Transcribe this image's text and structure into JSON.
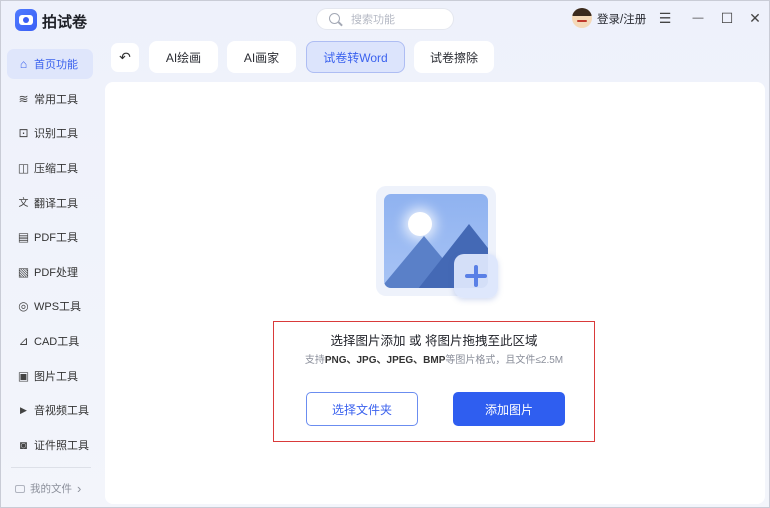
{
  "app": {
    "title": "拍试卷"
  },
  "search": {
    "placeholder": "搜索功能"
  },
  "account": {
    "login_label": "登录/注册"
  },
  "window_controls": {
    "menu": "☰",
    "minimize": "—",
    "maximize": "☐",
    "close": "✕"
  },
  "sidebar": {
    "items": [
      {
        "label": "首页功能",
        "icon": "home-icon",
        "glyph": "⌂",
        "active": true
      },
      {
        "label": "常用工具",
        "icon": "layers-icon",
        "glyph": "≋"
      },
      {
        "label": "识别工具",
        "icon": "scan-icon",
        "glyph": "⊡"
      },
      {
        "label": "压缩工具",
        "icon": "compress-icon",
        "glyph": "◫"
      },
      {
        "label": "翻译工具",
        "icon": "translate-icon",
        "glyph": "文"
      },
      {
        "label": "PDF工具",
        "icon": "pdf-icon",
        "glyph": "▤"
      },
      {
        "label": "PDF处理",
        "icon": "pdf-process-icon",
        "glyph": "▧"
      },
      {
        "label": "WPS工具",
        "icon": "wps-icon",
        "glyph": "◎"
      },
      {
        "label": "CAD工具",
        "icon": "cad-icon",
        "glyph": "⊿"
      },
      {
        "label": "图片工具",
        "icon": "image-icon",
        "glyph": "▣"
      },
      {
        "label": "音视频工具",
        "icon": "video-icon",
        "glyph": "▶"
      },
      {
        "label": "证件照工具",
        "icon": "id-photo-icon",
        "glyph": "◙"
      }
    ],
    "my_files": "我的文件",
    "my_files_chevron": "›"
  },
  "toolbar": {
    "back_glyph": "↶",
    "tabs": [
      {
        "label": "AI绘画"
      },
      {
        "label": "AI画家"
      },
      {
        "label": "试卷转Word",
        "active": true
      },
      {
        "label": "试卷擦除"
      }
    ]
  },
  "upload": {
    "title": "选择图片添加 或 将图片拖拽至此区域",
    "hint_prefix": "支持",
    "hint_formats": "PNG、JPG、JPEG、BMP",
    "hint_suffix": "等图片格式，且文件≤2.5M",
    "select_folder_label": "选择文件夹",
    "add_image_label": "添加图片"
  },
  "colors": {
    "accent": "#2f5ef0",
    "active_bg": "#dce4fc",
    "highlight_border": "#d93a3a"
  }
}
